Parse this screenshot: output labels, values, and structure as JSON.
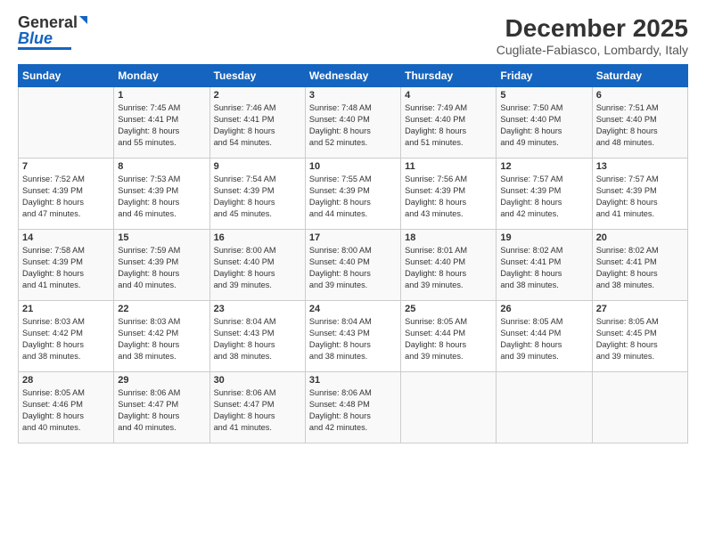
{
  "logo": {
    "line1": "General",
    "line2": "Blue"
  },
  "title": "December 2025",
  "subtitle": "Cugliate-Fabiasco, Lombardy, Italy",
  "headers": [
    "Sunday",
    "Monday",
    "Tuesday",
    "Wednesday",
    "Thursday",
    "Friday",
    "Saturday"
  ],
  "weeks": [
    [
      {
        "day": "",
        "content": ""
      },
      {
        "day": "1",
        "content": "Sunrise: 7:45 AM\nSunset: 4:41 PM\nDaylight: 8 hours\nand 55 minutes."
      },
      {
        "day": "2",
        "content": "Sunrise: 7:46 AM\nSunset: 4:41 PM\nDaylight: 8 hours\nand 54 minutes."
      },
      {
        "day": "3",
        "content": "Sunrise: 7:48 AM\nSunset: 4:40 PM\nDaylight: 8 hours\nand 52 minutes."
      },
      {
        "day": "4",
        "content": "Sunrise: 7:49 AM\nSunset: 4:40 PM\nDaylight: 8 hours\nand 51 minutes."
      },
      {
        "day": "5",
        "content": "Sunrise: 7:50 AM\nSunset: 4:40 PM\nDaylight: 8 hours\nand 49 minutes."
      },
      {
        "day": "6",
        "content": "Sunrise: 7:51 AM\nSunset: 4:40 PM\nDaylight: 8 hours\nand 48 minutes."
      }
    ],
    [
      {
        "day": "7",
        "content": "Sunrise: 7:52 AM\nSunset: 4:39 PM\nDaylight: 8 hours\nand 47 minutes."
      },
      {
        "day": "8",
        "content": "Sunrise: 7:53 AM\nSunset: 4:39 PM\nDaylight: 8 hours\nand 46 minutes."
      },
      {
        "day": "9",
        "content": "Sunrise: 7:54 AM\nSunset: 4:39 PM\nDaylight: 8 hours\nand 45 minutes."
      },
      {
        "day": "10",
        "content": "Sunrise: 7:55 AM\nSunset: 4:39 PM\nDaylight: 8 hours\nand 44 minutes."
      },
      {
        "day": "11",
        "content": "Sunrise: 7:56 AM\nSunset: 4:39 PM\nDaylight: 8 hours\nand 43 minutes."
      },
      {
        "day": "12",
        "content": "Sunrise: 7:57 AM\nSunset: 4:39 PM\nDaylight: 8 hours\nand 42 minutes."
      },
      {
        "day": "13",
        "content": "Sunrise: 7:57 AM\nSunset: 4:39 PM\nDaylight: 8 hours\nand 41 minutes."
      }
    ],
    [
      {
        "day": "14",
        "content": "Sunrise: 7:58 AM\nSunset: 4:39 PM\nDaylight: 8 hours\nand 41 minutes."
      },
      {
        "day": "15",
        "content": "Sunrise: 7:59 AM\nSunset: 4:39 PM\nDaylight: 8 hours\nand 40 minutes."
      },
      {
        "day": "16",
        "content": "Sunrise: 8:00 AM\nSunset: 4:40 PM\nDaylight: 8 hours\nand 39 minutes."
      },
      {
        "day": "17",
        "content": "Sunrise: 8:00 AM\nSunset: 4:40 PM\nDaylight: 8 hours\nand 39 minutes."
      },
      {
        "day": "18",
        "content": "Sunrise: 8:01 AM\nSunset: 4:40 PM\nDaylight: 8 hours\nand 39 minutes."
      },
      {
        "day": "19",
        "content": "Sunrise: 8:02 AM\nSunset: 4:41 PM\nDaylight: 8 hours\nand 38 minutes."
      },
      {
        "day": "20",
        "content": "Sunrise: 8:02 AM\nSunset: 4:41 PM\nDaylight: 8 hours\nand 38 minutes."
      }
    ],
    [
      {
        "day": "21",
        "content": "Sunrise: 8:03 AM\nSunset: 4:42 PM\nDaylight: 8 hours\nand 38 minutes."
      },
      {
        "day": "22",
        "content": "Sunrise: 8:03 AM\nSunset: 4:42 PM\nDaylight: 8 hours\nand 38 minutes."
      },
      {
        "day": "23",
        "content": "Sunrise: 8:04 AM\nSunset: 4:43 PM\nDaylight: 8 hours\nand 38 minutes."
      },
      {
        "day": "24",
        "content": "Sunrise: 8:04 AM\nSunset: 4:43 PM\nDaylight: 8 hours\nand 38 minutes."
      },
      {
        "day": "25",
        "content": "Sunrise: 8:05 AM\nSunset: 4:44 PM\nDaylight: 8 hours\nand 39 minutes."
      },
      {
        "day": "26",
        "content": "Sunrise: 8:05 AM\nSunset: 4:44 PM\nDaylight: 8 hours\nand 39 minutes."
      },
      {
        "day": "27",
        "content": "Sunrise: 8:05 AM\nSunset: 4:45 PM\nDaylight: 8 hours\nand 39 minutes."
      }
    ],
    [
      {
        "day": "28",
        "content": "Sunrise: 8:05 AM\nSunset: 4:46 PM\nDaylight: 8 hours\nand 40 minutes."
      },
      {
        "day": "29",
        "content": "Sunrise: 8:06 AM\nSunset: 4:47 PM\nDaylight: 8 hours\nand 40 minutes."
      },
      {
        "day": "30",
        "content": "Sunrise: 8:06 AM\nSunset: 4:47 PM\nDaylight: 8 hours\nand 41 minutes."
      },
      {
        "day": "31",
        "content": "Sunrise: 8:06 AM\nSunset: 4:48 PM\nDaylight: 8 hours\nand 42 minutes."
      },
      {
        "day": "",
        "content": ""
      },
      {
        "day": "",
        "content": ""
      },
      {
        "day": "",
        "content": ""
      }
    ]
  ]
}
